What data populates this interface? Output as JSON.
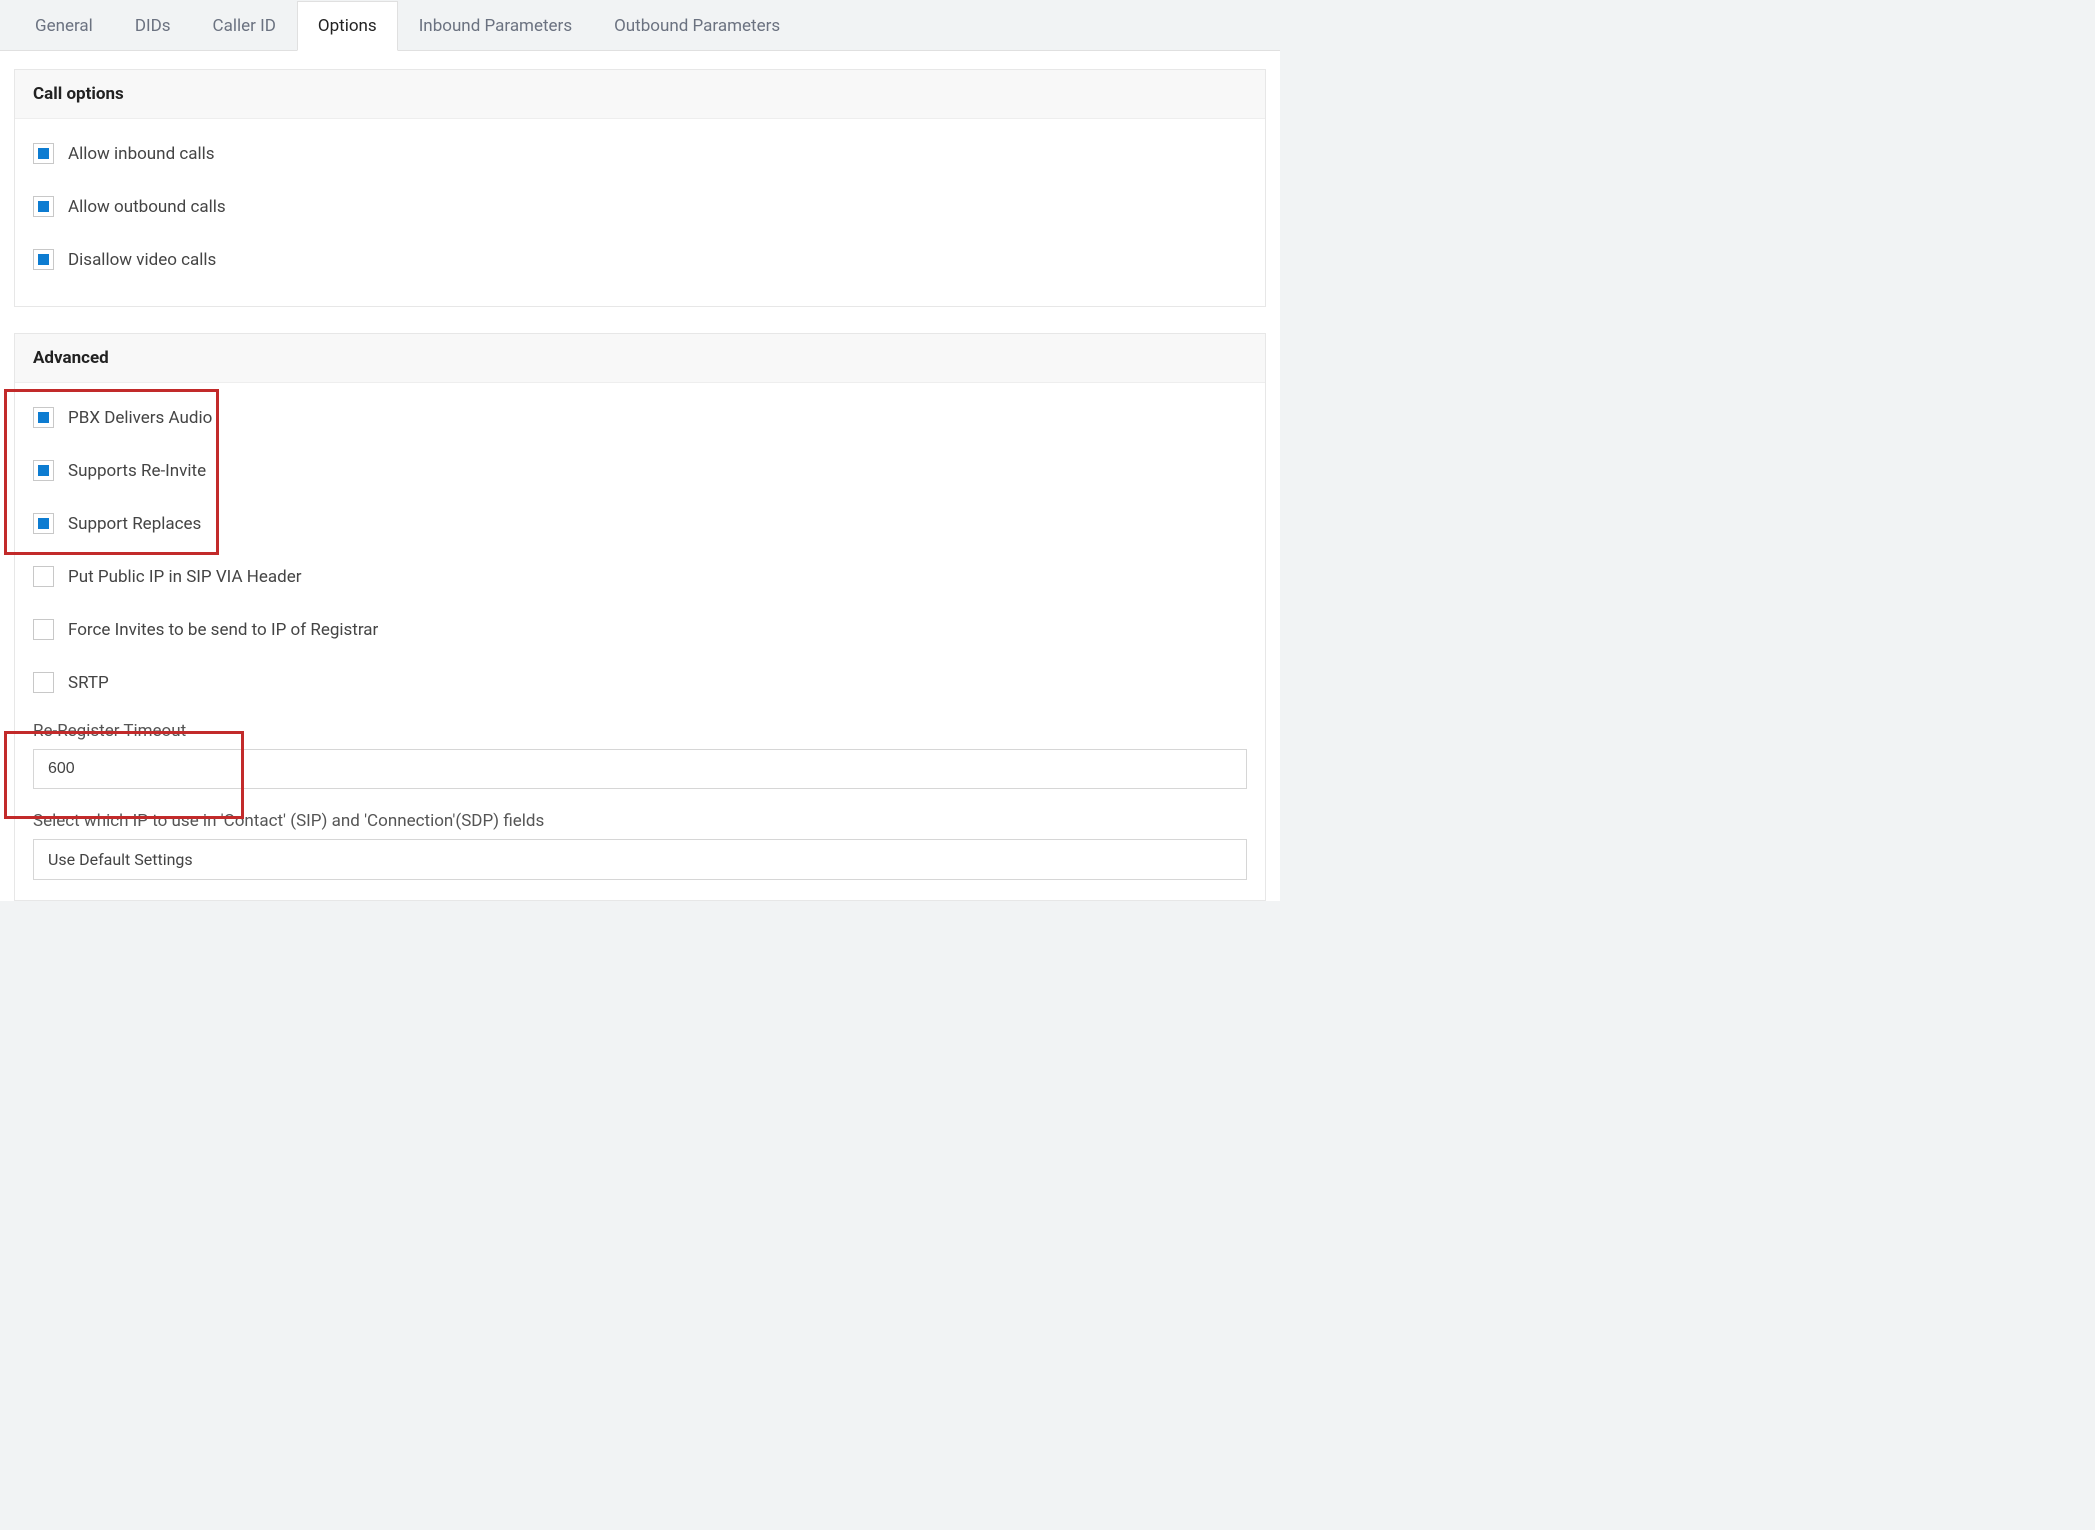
{
  "tabs": {
    "items": [
      {
        "label": "General",
        "active": false
      },
      {
        "label": "DIDs",
        "active": false
      },
      {
        "label": "Caller ID",
        "active": false
      },
      {
        "label": "Options",
        "active": true
      },
      {
        "label": "Inbound Parameters",
        "active": false
      },
      {
        "label": "Outbound Parameters",
        "active": false
      }
    ]
  },
  "panels": {
    "call_options": {
      "title": "Call options",
      "checkboxes": [
        {
          "label": "Allow inbound calls",
          "checked": true
        },
        {
          "label": "Allow outbound calls",
          "checked": true
        },
        {
          "label": "Disallow video calls",
          "checked": true
        }
      ]
    },
    "advanced": {
      "title": "Advanced",
      "checkboxes": [
        {
          "label": "PBX Delivers Audio",
          "checked": true
        },
        {
          "label": "Supports Re-Invite",
          "checked": true
        },
        {
          "label": "Support Replaces",
          "checked": true
        },
        {
          "label": "Put Public IP in SIP VIA Header",
          "checked": false
        },
        {
          "label": "Force Invites to be send to IP of Registrar",
          "checked": false
        },
        {
          "label": "SRTP",
          "checked": false
        }
      ],
      "reregister_label": "Re-Register Timeout",
      "reregister_value": "600",
      "ip_select_label": "Select which IP to use in 'Contact' (SIP) and 'Connection'(SDP) fields",
      "ip_select_value": "Use Default Settings"
    }
  }
}
